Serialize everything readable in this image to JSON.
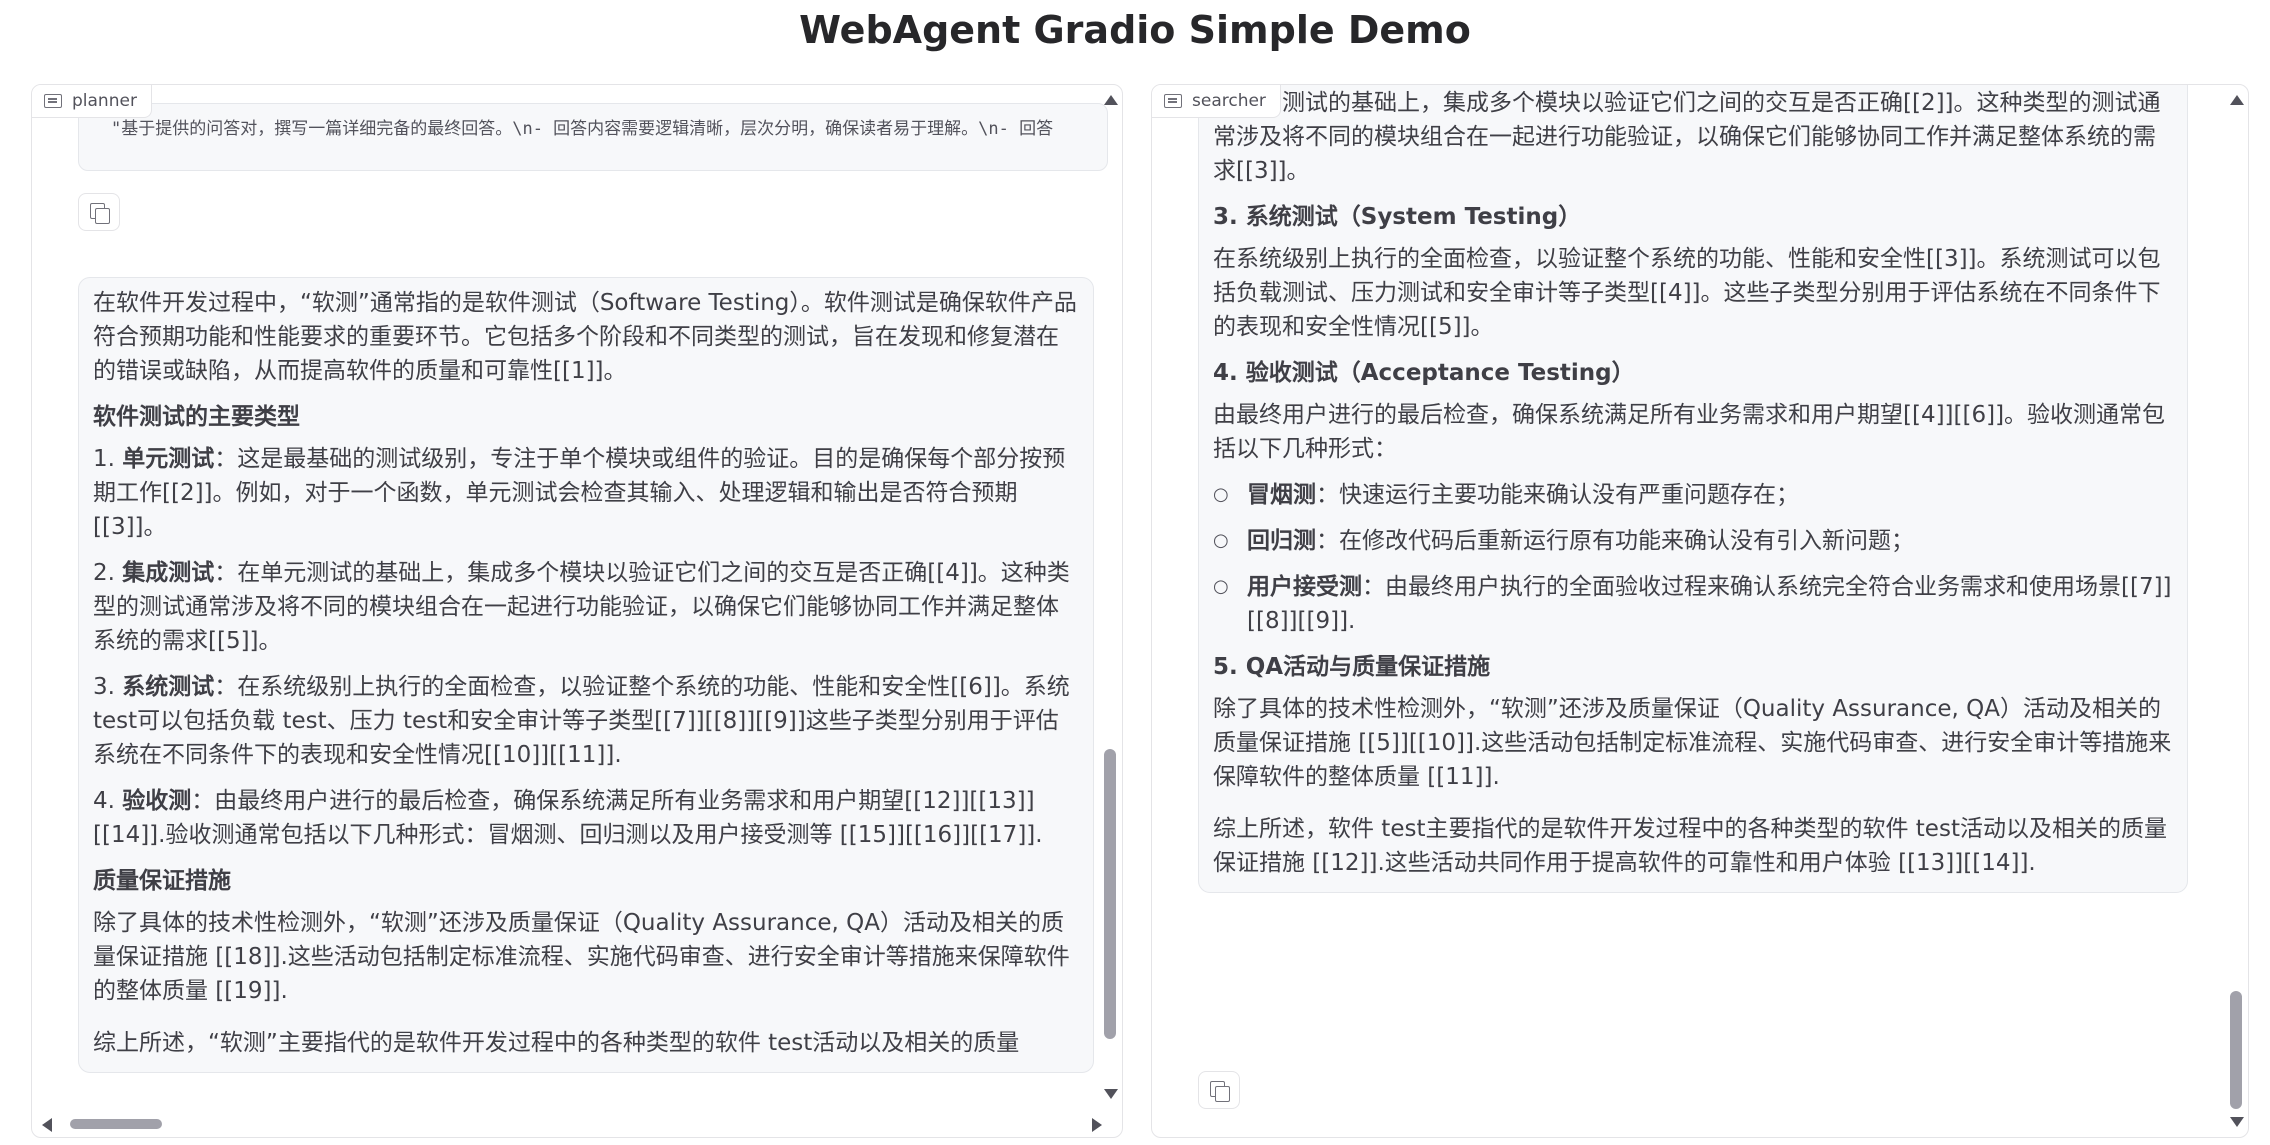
{
  "page": {
    "title": "WebAgent Gradio Simple Demo"
  },
  "planner": {
    "label": "planner",
    "code_message": "\"基于提供的问答对，撰写一篇详细完备的最终回答。\\n- 回答内容需要逻辑清晰，层次分明，确保读者易于理解。\\n- 回答",
    "answer": {
      "intro": "在软件开发过程中，“软测”通常指的是软件测试（Software Testing）。软件测试是确保软件产品符合预期功能和性能要求的重要环节。它包括多个阶段和不同类型的测试，旨在发现和修复潜在的错误或缺陷，从而提高软件的质量和可靠性[[1]]。",
      "heading_types": "软件测试的主要类型",
      "items": [
        {
          "num": "1. ",
          "term": "单元测试",
          "text": "：这是最基础的测试级别，专注于单个模块或组件的验证。目的是确保每个部分按预期工作[[2]]。例如，对于一个函数，单元测试会检查其输入、处理逻辑和输出是否符合预期[[3]]。"
        },
        {
          "num": "2. ",
          "term": "集成测试",
          "text": "：在单元测试的基础上，集成多个模块以验证它们之间的交互是否正确[[4]]。这种类型的测试通常涉及将不同的模块组合在一起进行功能验证，以确保它们能够协同工作并满足整体系统的需求[[5]]。"
        },
        {
          "num": "3. ",
          "term": "系统测试",
          "text": "：在系统级别上执行的全面检查，以验证整个系统的功能、性能和安全性[[6]]。系统 test可以包括负载 test、压力 test和安全审计等子类型[[7]][[8]][[9]]这些子类型分别用于评估系统在不同条件下的表现和安全性情况[[10]][[11]]."
        },
        {
          "num": "4. ",
          "term": "验收测",
          "text": "：由最终用户进行的最后检查，确保系统满足所有业务需求和用户期望[[12]][[13]][[14]].验收测通常包括以下几种形式：冒烟测、回归测以及用户接受测等 [[15]][[16]][[17]]."
        }
      ],
      "heading_qa": "质量保证措施",
      "qa_text": "除了具体的技术性检测外，“软测”还涉及质量保证（Quality Assurance, QA）活动及相关的质量保证措施 [[18]].这些活动包括制定标准流程、实施代码审查、进行安全审计等措施来保障软件的整体质量 [[19]].",
      "summary_partial": "综上所述，“软测”主要指代的是软件开发过程中的各种类型的软件 test活动以及相关的质量"
    }
  },
  "searcher": {
    "label": "searcher",
    "answer": {
      "top_text": "在单元测试的基础上，集成多个模块以验证它们之间的交互是否正确[[2]]。这种类型的测试通常涉及将不同的模块组合在一起进行功能验证，以确保它们能够协同工作并满足整体系统的需求[[3]]。",
      "h3": "3. 系统测试（System Testing）",
      "p3": "在系统级别上执行的全面检查，以验证整个系统的功能、性能和安全性[[3]]。系统测试可以包括负载测试、压力测试和安全审计等子类型[[4]]。这些子类型分别用于评估系统在不同条件下的表现和安全性情况[[5]]。",
      "h4": "4. 验收测试（Acceptance Testing）",
      "p4": "由最终用户进行的最后检查，确保系统满足所有业务需求和用户期望[[4]][[6]]。验收测通常包括以下几种形式：",
      "bullets": [
        {
          "term": "冒烟测",
          "text": "：快速运行主要功能来确认没有严重问题存在；"
        },
        {
          "term": "回归测",
          "text": "：在修改代码后重新运行原有功能来确认没有引入新问题；"
        },
        {
          "term": "用户接受测",
          "text": "：由最终用户执行的全面验收过程来确认系统完全符合业务需求和使用场景[[7]][[8]][[9]]."
        }
      ],
      "h5": "5. QA活动与质量保证措施",
      "p5": "除了具体的技术性检测外，“软测”还涉及质量保证（Quality Assurance, QA）活动及相关的质量保证措施 [[5]][[10]].这些活动包括制定标准流程、实施代码审查、进行安全审计等措施来保障软件的整体质量 [[11]].",
      "p6": "综上所述，软件 test主要指代的是软件开发过程中的各种类型的软件 test活动以及相关的质量保证措施 [[12]].这些活动共同作用于提高软件的可靠性和用户体验 [[13]][[14]]."
    }
  },
  "icons": {
    "panel_label": "chat-icon",
    "copy": "copy-icon"
  }
}
